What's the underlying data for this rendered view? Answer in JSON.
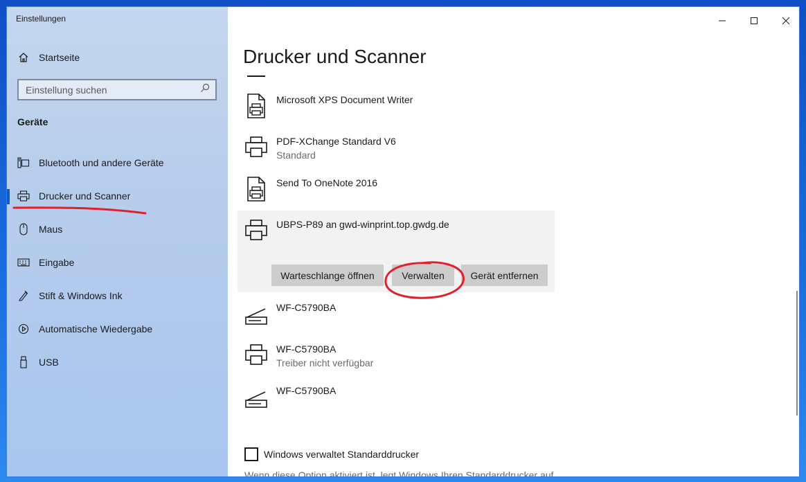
{
  "window": {
    "title": "Einstellungen"
  },
  "sidebar": {
    "home_label": "Startseite",
    "search_placeholder": "Einstellung suchen",
    "section_title": "Geräte",
    "items": [
      {
        "label": "Bluetooth und andere Geräte",
        "icon": "bluetooth-devices-icon"
      },
      {
        "label": "Drucker und Scanner",
        "icon": "printer-icon",
        "active": true
      },
      {
        "label": "Maus",
        "icon": "mouse-icon"
      },
      {
        "label": "Eingabe",
        "icon": "keyboard-icon"
      },
      {
        "label": "Stift & Windows Ink",
        "icon": "pen-icon"
      },
      {
        "label": "Automatische Wiedergabe",
        "icon": "autoplay-icon"
      },
      {
        "label": "USB",
        "icon": "usb-icon"
      }
    ]
  },
  "main": {
    "title": "Drucker und Scanner",
    "printers": [
      {
        "name": "Microsoft XPS Document Writer",
        "sub": "",
        "icon": "document-printer-icon"
      },
      {
        "name": "PDF-XChange Standard V6",
        "sub": "Standard",
        "icon": "printer-icon"
      },
      {
        "name": "Send To OneNote 2016",
        "sub": "",
        "icon": "document-printer-icon"
      },
      {
        "name": "UBPS-P89 an gwd-winprint.top.gwdg.de",
        "sub": "",
        "icon": "printer-icon",
        "selected": true
      },
      {
        "name": "WF-C5790BA",
        "sub": "",
        "icon": "scanner-icon"
      },
      {
        "name": "WF-C5790BA",
        "sub": "Treiber nicht verfügbar",
        "icon": "printer-icon"
      },
      {
        "name": "WF-C5790BA",
        "sub": "",
        "icon": "scanner-icon"
      }
    ],
    "actions": {
      "open_queue": "Warteschlange öffnen",
      "manage": "Verwalten",
      "remove": "Gerät entfernen"
    },
    "checkbox_label": "Windows verwaltet Standarddrucker",
    "description": "Wenn diese Option aktiviert ist, legt Windows Ihren Standarddrucker auf"
  },
  "colors": {
    "accent": "#0a5ad4",
    "annotation": "#e0202a",
    "sidebar_bg": "#b7cdec",
    "button_bg": "#cccccc",
    "selected_bg": "#f2f2f2"
  }
}
